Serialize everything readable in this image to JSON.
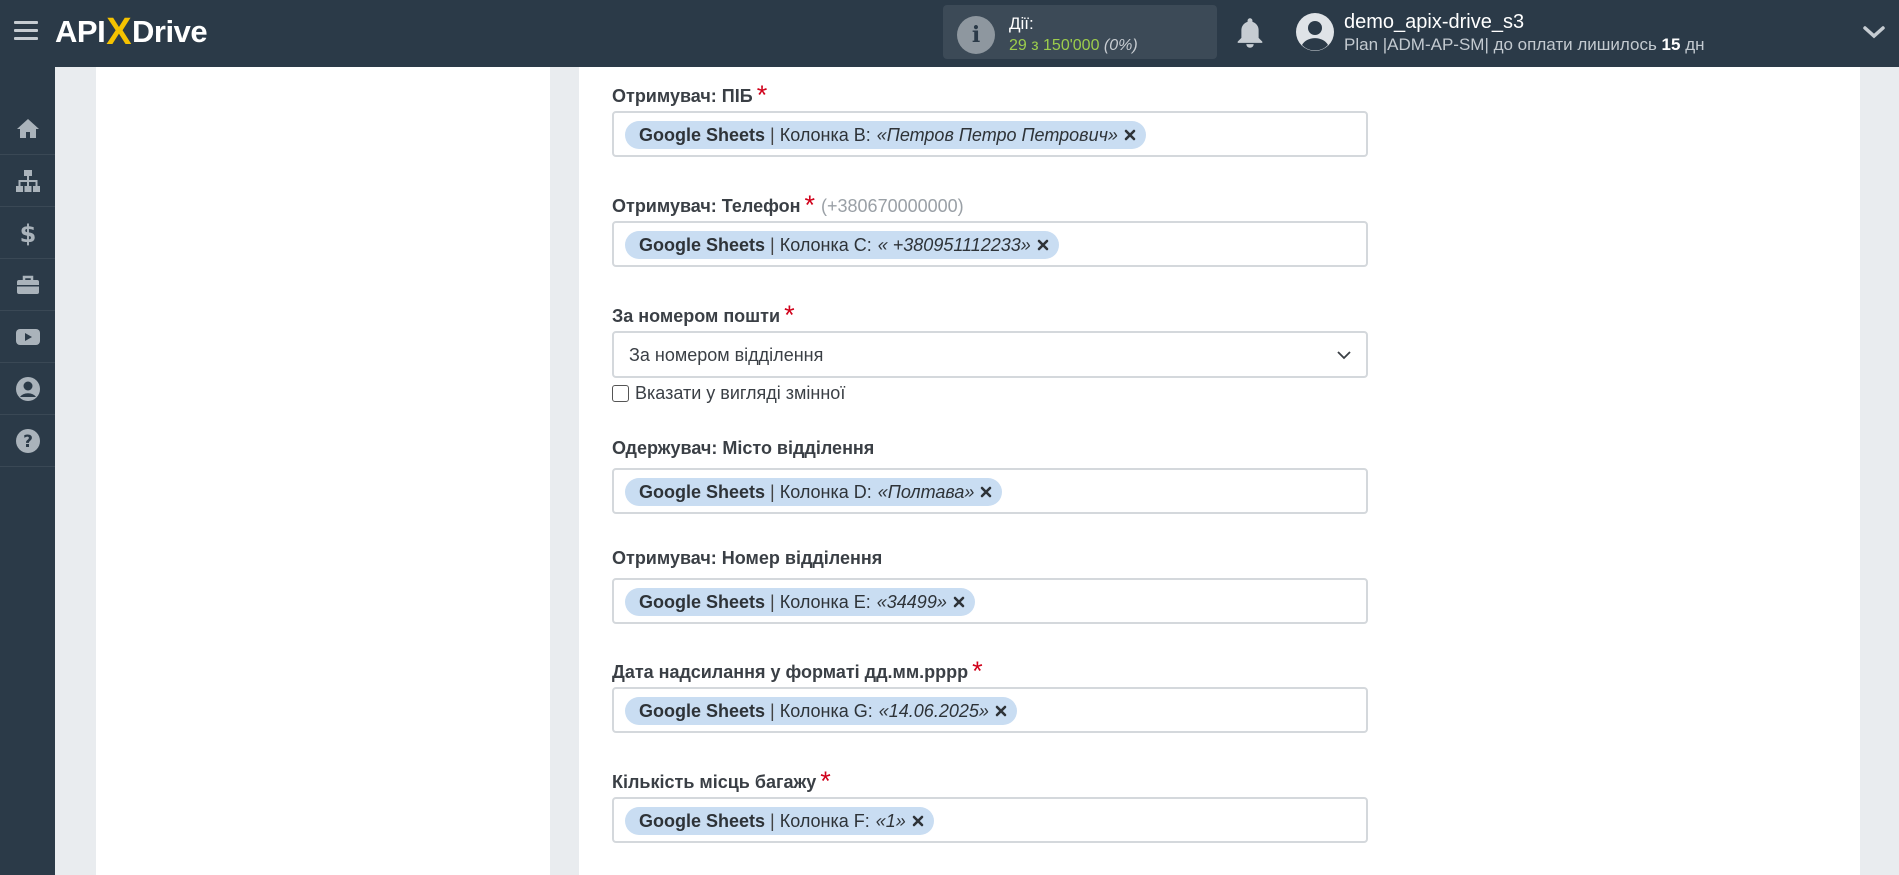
{
  "header": {
    "logo_api": "API",
    "logo_x": "X",
    "logo_drive": "Drive",
    "actions_label": "Дії:",
    "actions_count": "29 з 150'000",
    "actions_percent": "(0%)",
    "user_name": "demo_apix-drive_s3",
    "plan_prefix": "Plan |ADM-AP-SM| до оплати лишилось ",
    "plan_days": "15",
    "plan_suffix": " дн"
  },
  "sidebar": {
    "items": [
      {
        "name": "home",
        "icon": "home-icon"
      },
      {
        "name": "connections",
        "icon": "sitemap-icon"
      },
      {
        "name": "billing",
        "icon": "dollar-icon"
      },
      {
        "name": "tools",
        "icon": "briefcase-icon"
      },
      {
        "name": "video",
        "icon": "youtube-icon"
      },
      {
        "name": "account",
        "icon": "user-circle-icon"
      },
      {
        "name": "help",
        "icon": "question-icon"
      }
    ]
  },
  "form": {
    "fields": [
      {
        "label": "Отримувач: ПІБ",
        "required": true,
        "source": "Google Sheets",
        "column": "Колонка B:",
        "value": "«Петров Петро Петрович»"
      },
      {
        "label": "Отримувач: Телефон",
        "required": true,
        "hint": "(+380670000000)",
        "source": "Google Sheets",
        "column": "Колонка C:",
        "value": "« +380951112233»"
      },
      {
        "label": "Одержувач: Місто відділення",
        "required": false,
        "source": "Google Sheets",
        "column": "Колонка D:",
        "value": "«Полтава»"
      },
      {
        "label": "Отримувач: Номер відділення",
        "required": false,
        "source": "Google Sheets",
        "column": "Колонка E:",
        "value": "«34499»"
      },
      {
        "label": "Дата надсилання у форматі дд.мм.рррр",
        "required": true,
        "source": "Google Sheets",
        "column": "Колонка G:",
        "value": "«14.06.2025»"
      },
      {
        "label": "Кількість місць багажу",
        "required": true,
        "source": "Google Sheets",
        "column": "Колонка F:",
        "value": "«1»"
      }
    ],
    "post_number": {
      "label": "За номером пошти",
      "selected": "За номером відділення",
      "checkbox_label": "Вказати у вигляді змінної"
    },
    "required_mark": "*",
    "tag_separator": "|"
  }
}
